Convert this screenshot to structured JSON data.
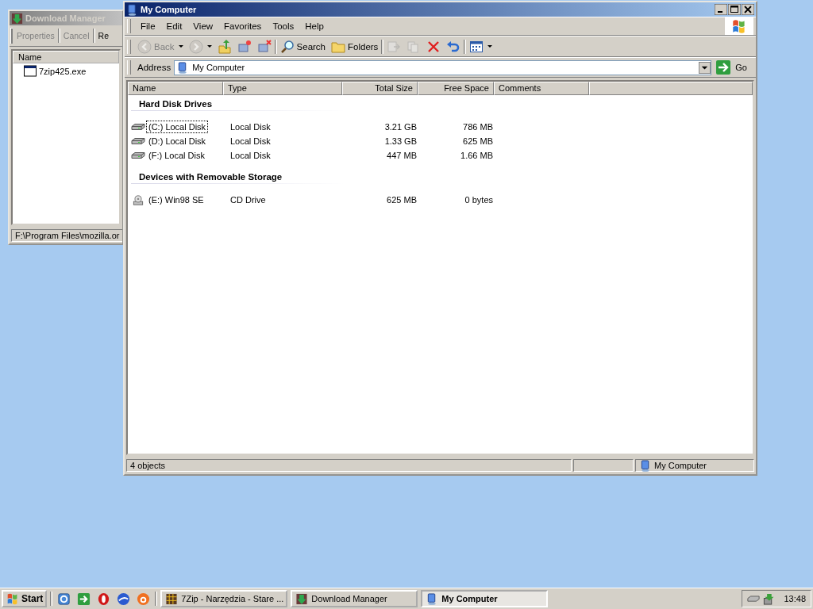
{
  "download_manager": {
    "title": "Download Manager",
    "toolbar": [
      {
        "label": "Properties",
        "disabled": true
      },
      {
        "label": "Cancel",
        "disabled": true
      },
      {
        "label": "Re",
        "disabled": false
      }
    ],
    "columns": [
      "Name"
    ],
    "items": [
      {
        "name": "7zip425.exe"
      }
    ],
    "status": "F:\\Program Files\\mozilla.or"
  },
  "my_computer": {
    "title": "My Computer",
    "menu": [
      "File",
      "Edit",
      "View",
      "Favorites",
      "Tools",
      "Help"
    ],
    "toolbar": [
      [
        {
          "kind": "back",
          "label": "Back",
          "disabled": true,
          "dropdown": true
        },
        {
          "kind": "forward",
          "disabled": true,
          "dropdown": true
        },
        {
          "kind": "up",
          "disabled": false
        },
        {
          "kind": "map-drive",
          "disabled": false
        },
        {
          "kind": "disconnect-drive",
          "disabled": false
        }
      ],
      [
        {
          "kind": "search",
          "label": "Search",
          "disabled": false
        },
        {
          "kind": "folders",
          "label": "Folders",
          "disabled": false
        }
      ],
      [
        {
          "kind": "move-to",
          "disabled": true
        },
        {
          "kind": "copy-to",
          "disabled": true
        },
        {
          "kind": "delete",
          "disabled": false
        },
        {
          "kind": "undo",
          "disabled": false
        }
      ],
      [
        {
          "kind": "views",
          "disabled": false,
          "dropdown": true
        }
      ]
    ],
    "address": {
      "label": "Address",
      "value": "My Computer",
      "go": "Go"
    },
    "columns": [
      "Name",
      "Type",
      "Total Size",
      "Free Space",
      "Comments"
    ],
    "groups": [
      {
        "title": "Hard Disk Drives",
        "items": [
          {
            "kind": "disk",
            "name": "(C:) Local Disk",
            "type": "Local Disk",
            "total": "3.21 GB",
            "free": "786 MB",
            "focused": true
          },
          {
            "kind": "disk",
            "name": "(D:) Local Disk",
            "type": "Local Disk",
            "total": "1.33 GB",
            "free": "625 MB",
            "focused": false
          },
          {
            "kind": "disk",
            "name": "(F:) Local Disk",
            "type": "Local Disk",
            "total": "447 MB",
            "free": "1.66 MB",
            "focused": false
          }
        ]
      },
      {
        "title": "Devices with Removable Storage",
        "items": [
          {
            "kind": "cd",
            "name": "(E:) Win98 SE",
            "type": "CD Drive",
            "total": "625 MB",
            "free": "0 bytes",
            "focused": false
          }
        ]
      }
    ],
    "status_bar": {
      "objects": "4 objects",
      "location": "My Computer"
    }
  },
  "taskbar": {
    "start": "Start",
    "quick_launch": [
      {
        "kind": "browser"
      },
      {
        "kind": "show-desktop"
      },
      {
        "kind": "opera"
      },
      {
        "kind": "globe"
      },
      {
        "kind": "orange"
      }
    ],
    "tasks": [
      {
        "kind": "grid",
        "label": "7Zip - Narzędzia - Stare ...",
        "selected": false
      },
      {
        "kind": "download",
        "label": "Download Manager",
        "selected": false
      },
      {
        "kind": "computer",
        "label": "My Computer",
        "selected": true
      }
    ],
    "clock": "13:48"
  }
}
